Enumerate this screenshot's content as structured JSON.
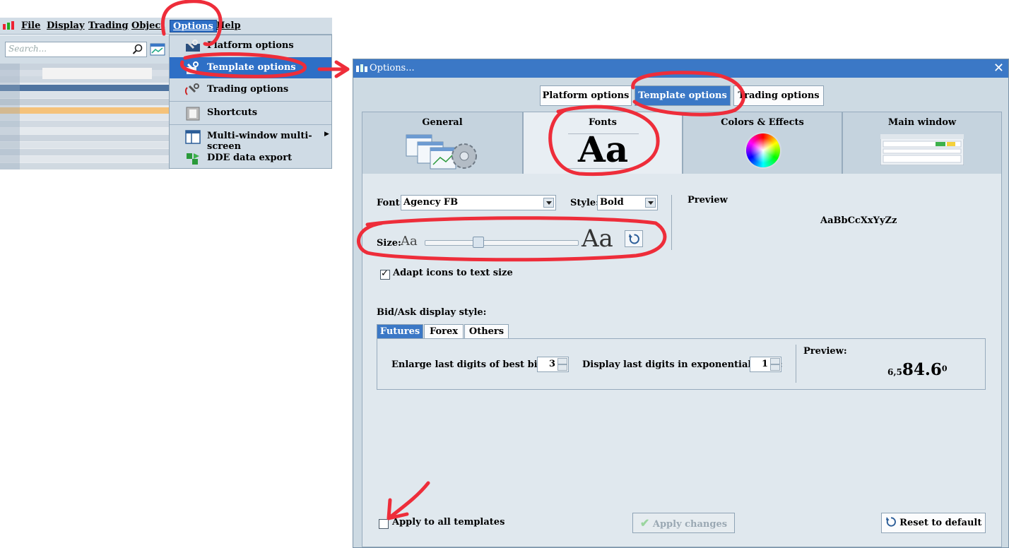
{
  "menubar": {
    "items": [
      "File",
      "Display",
      "Trading",
      "Object",
      "Options",
      "Help"
    ],
    "active": "Options"
  },
  "search": {
    "placeholder": "Search..."
  },
  "options_menu": {
    "items": [
      {
        "label": "Platform options",
        "icon": "wrench-monitor-icon"
      },
      {
        "label": "Template options",
        "icon": "wrench-template-icon",
        "selected": true
      },
      {
        "label": "Trading options",
        "icon": "wrench-trading-icon"
      },
      {
        "label": "Shortcuts",
        "icon": "shortcuts-icon"
      },
      {
        "label": "Multi-window multi-screen",
        "icon": "multi-window-icon",
        "submenu": true
      },
      {
        "label": "DDE data export",
        "icon": "dde-export-icon"
      }
    ]
  },
  "dialog": {
    "title": "Options...",
    "close": "✕",
    "top_tabs": [
      "Platform options",
      "Template options",
      "Trading options"
    ],
    "active_top_tab": "Template options",
    "sections": [
      "General",
      "Fonts",
      "Colors & Effects",
      "Main window"
    ],
    "active_section": "Fonts",
    "fonts_glyph": "Aa",
    "font": {
      "font_label": "Font:",
      "font_value": "Agency FB",
      "style_label": "Style:",
      "style_value": "Bold",
      "size_label": "Size:",
      "size_small": "Aa",
      "size_large": "Aa",
      "slider_level": 0.33
    },
    "preview": {
      "label": "Preview",
      "sample": "AaBbCcXxYyZz"
    },
    "adapt_icons": {
      "label": "Adapt icons to text size",
      "checked": true
    },
    "bidask": {
      "label": "Bid/Ask display style:",
      "tabs": [
        "Futures",
        "Forex",
        "Others"
      ],
      "active_tab": "Futures",
      "enlarge_label": "Enlarge last digits of best bid/ask:",
      "enlarge_value": "3",
      "exp_label": "Display last digits in exponential form:",
      "exp_value": "1",
      "preview_label": "Preview:",
      "preview_small": "6,5",
      "preview_big": "84.6",
      "preview_sup": "0"
    },
    "apply_all": {
      "label": "Apply to all templates",
      "checked": false
    },
    "apply_changes": "Apply changes",
    "reset_default": "Reset to default"
  },
  "colors": {
    "accent": "#3b78c6",
    "annotation": "#ee2d3a",
    "panel": "#e0e8ee"
  }
}
